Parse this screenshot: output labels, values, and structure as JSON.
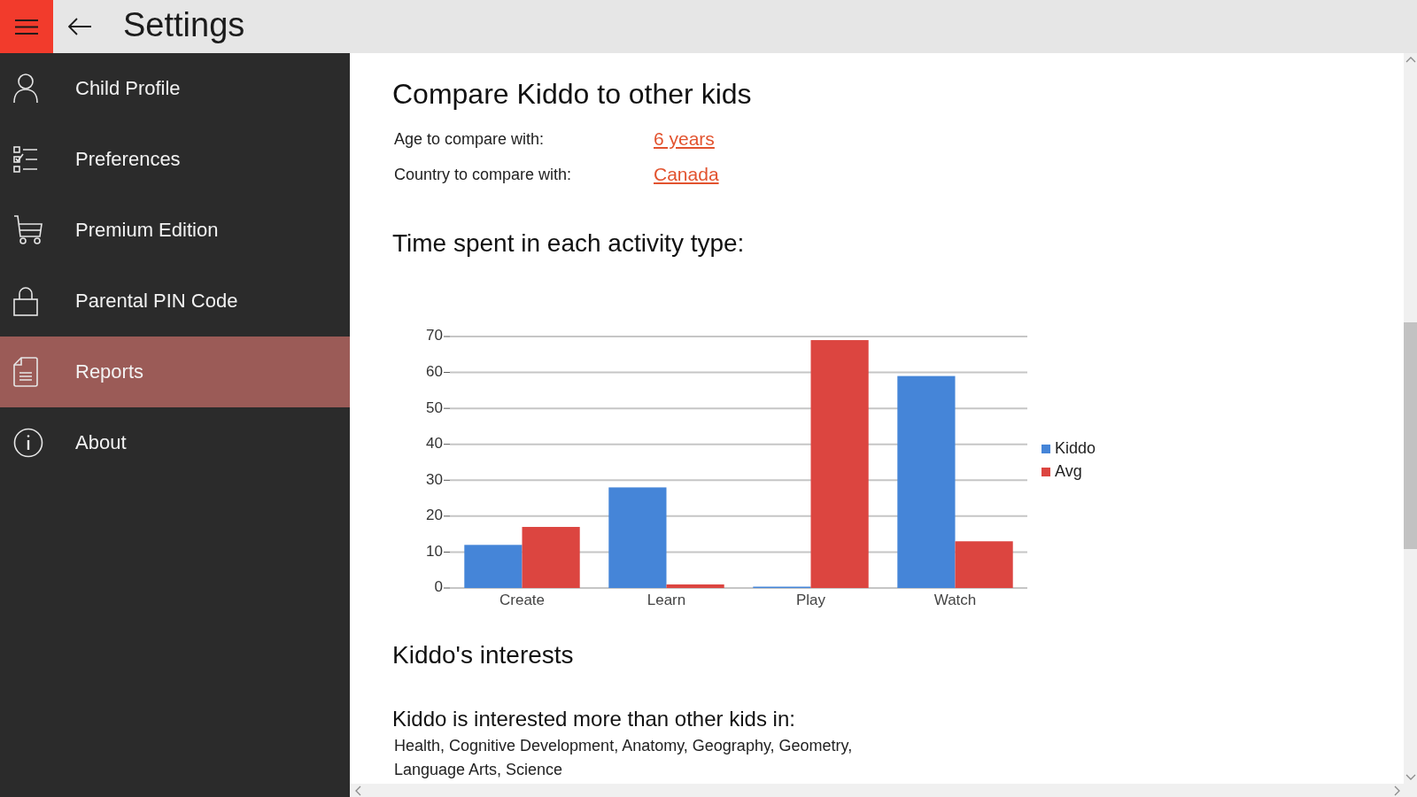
{
  "header": {
    "title": "Settings"
  },
  "sidebar": {
    "items": [
      {
        "label": "Child Profile",
        "selected": false
      },
      {
        "label": "Preferences",
        "selected": false
      },
      {
        "label": "Premium Edition",
        "selected": false
      },
      {
        "label": "Parental PIN Code",
        "selected": false
      },
      {
        "label": "Reports",
        "selected": true
      },
      {
        "label": "About",
        "selected": false
      }
    ]
  },
  "compare": {
    "title": "Compare Kiddo to other kids",
    "fields": [
      {
        "label": "Age to compare with:",
        "value": "6 years"
      },
      {
        "label": "Country to compare with:",
        "value": "Canada"
      }
    ]
  },
  "activity": {
    "title": "Time spent in each activity type:",
    "chart_data": {
      "type": "bar",
      "categories": [
        "Create",
        "Learn",
        "Play",
        "Watch"
      ],
      "series": [
        {
          "name": "Kiddo",
          "color": "#4585d8",
          "values": [
            12,
            28,
            0,
            59
          ]
        },
        {
          "name": "Avg",
          "color": "#dc4540",
          "values": [
            17,
            1,
            69,
            13
          ]
        }
      ],
      "ylim": [
        0,
        70
      ],
      "yticks": [
        0,
        10,
        20,
        30,
        40,
        50,
        60,
        70
      ],
      "grid": true,
      "legend": "right"
    }
  },
  "interests": {
    "title": "Kiddo's interests",
    "subtitle": "Kiddo is interested more than other kids in:",
    "text": "Health, Cognitive Development, Anatomy, Geography, Geometry, Language Arts, Science"
  }
}
